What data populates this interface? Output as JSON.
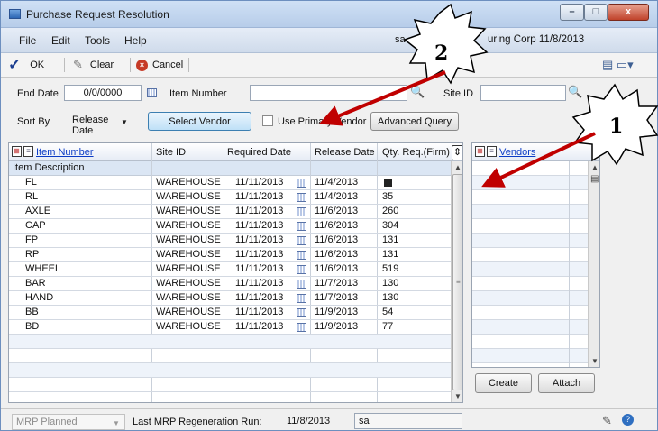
{
  "window": {
    "title": "Purchase Request Resolution",
    "controls": {
      "minimize": "–",
      "maximize": "□",
      "close": "x"
    }
  },
  "menubar": {
    "items": [
      "File",
      "Edit",
      "Tools",
      "Help"
    ],
    "user": "sa",
    "company_date": "uring Corp 11/8/2013"
  },
  "toolbar": {
    "ok_label": "OK",
    "clear_label": "Clear",
    "cancel_label": "Cancel"
  },
  "filters": {
    "end_date_label": "End Date",
    "end_date_value": "0/0/0000",
    "item_number_label": "Item Number",
    "item_number_value": "",
    "site_id_label": "Site ID",
    "site_id_value": "",
    "sort_by_label": "Sort By",
    "sort_by_value": "Release Date",
    "select_vendor_label": "Select Vendor",
    "use_primary_vendor_label": "Use Primary Vendor",
    "advanced_query_label": "Advanced Query"
  },
  "grid": {
    "columns": [
      "Item Number",
      "Site ID",
      "Required Date",
      "Release Date",
      "Qty. Req.(Firm)"
    ],
    "subheader": "Item Description",
    "rows": [
      {
        "item": "FL",
        "site": "WAREHOUSE",
        "required": "11/11/2013",
        "release": "11/4/2013",
        "qty": ""
      },
      {
        "item": "RL",
        "site": "WAREHOUSE",
        "required": "11/11/2013",
        "release": "11/4/2013",
        "qty": "35"
      },
      {
        "item": "AXLE",
        "site": "WAREHOUSE",
        "required": "11/11/2013",
        "release": "11/6/2013",
        "qty": "260"
      },
      {
        "item": "CAP",
        "site": "WAREHOUSE",
        "required": "11/11/2013",
        "release": "11/6/2013",
        "qty": "304"
      },
      {
        "item": "FP",
        "site": "WAREHOUSE",
        "required": "11/11/2013",
        "release": "11/6/2013",
        "qty": "131"
      },
      {
        "item": "RP",
        "site": "WAREHOUSE",
        "required": "11/11/2013",
        "release": "11/6/2013",
        "qty": "131"
      },
      {
        "item": "WHEEL",
        "site": "WAREHOUSE",
        "required": "11/11/2013",
        "release": "11/6/2013",
        "qty": "519"
      },
      {
        "item": "BAR",
        "site": "WAREHOUSE",
        "required": "11/11/2013",
        "release": "11/7/2013",
        "qty": "130"
      },
      {
        "item": "HAND",
        "site": "WAREHOUSE",
        "required": "11/11/2013",
        "release": "11/7/2013",
        "qty": "130"
      },
      {
        "item": "BB",
        "site": "WAREHOUSE",
        "required": "11/11/2013",
        "release": "11/9/2013",
        "qty": "54"
      },
      {
        "item": "BD",
        "site": "WAREHOUSE",
        "required": "11/11/2013",
        "release": "11/9/2013",
        "qty": "77"
      }
    ]
  },
  "vendors": {
    "header": "Vendors",
    "create_label": "Create",
    "attach_label": "Attach"
  },
  "status": {
    "mrp_value": "MRP Planned",
    "last_run_label": "Last MRP Regeneration Run:",
    "last_run_date": "11/8/2013",
    "last_run_user": "sa"
  },
  "annotations": {
    "callout_1": "1",
    "callout_2": "2",
    "arrow_color": "#c00000"
  }
}
